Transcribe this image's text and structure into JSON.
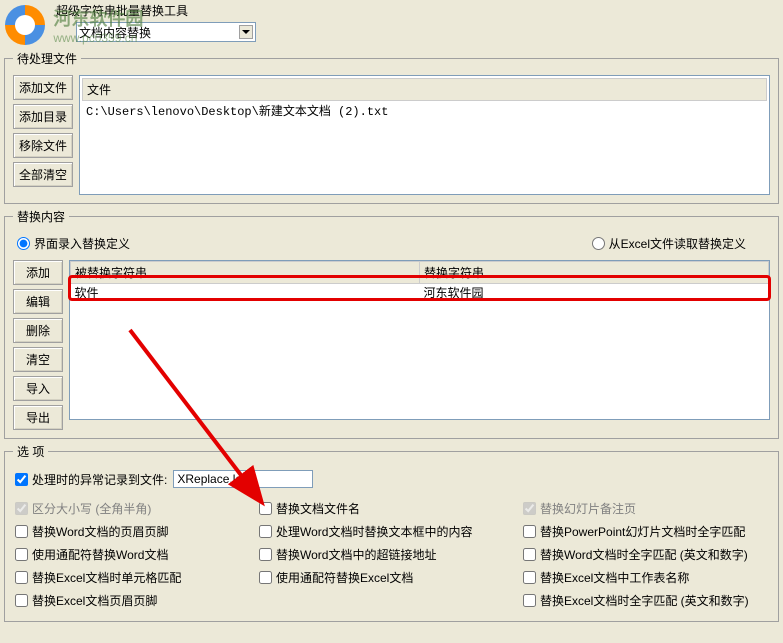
{
  "title": "超级字符串批量替换工具",
  "watermark": {
    "cn": "河东软件园",
    "url": "www.pc0359.cn"
  },
  "toolbar": {
    "mode_label": "文档内容替换"
  },
  "pending": {
    "legend": "待处理文件",
    "btn_add_file": "添加文件",
    "btn_add_dir": "添加目录",
    "btn_remove": "移除文件",
    "btn_clear": "全部清空",
    "col_header": "文件",
    "items": [
      "C:\\Users\\lenovo\\Desktop\\新建文本文档 (2).txt"
    ]
  },
  "replace": {
    "legend": "替换内容",
    "radio_ui": "界面录入替换定义",
    "radio_excel": "从Excel文件读取替换定义",
    "btn_add": "添加",
    "btn_edit": "编辑",
    "btn_delete": "删除",
    "btn_clear": "清空",
    "btn_import": "导入",
    "btn_export": "导出",
    "col_from": "被替换字符串",
    "col_to": "替换字符串",
    "rows": [
      {
        "from": "软件",
        "to": "河东软件园"
      }
    ]
  },
  "options": {
    "legend": "选  项",
    "log_label": "处理时的异常记录到文件:",
    "log_value": "XReplace.log",
    "c1r1": "区分大小写 (全角半角)",
    "c2r1": "替换文档文件名",
    "c3r1": "替换幻灯片备注页",
    "c1r2": "替换Word文档的页眉页脚",
    "c2r2": "处理Word文档时替换文本框中的内容",
    "c3r2": "替换PowerPoint幻灯片文档时全字匹配",
    "c1r3": "使用通配符替换Word文档",
    "c2r3": "替换Word文档中的超链接地址",
    "c3r3": "替换Word文档时全字匹配 (英文和数字)",
    "c1r4": "替换Excel文档时单元格匹配",
    "c2r4": "使用通配符替换Excel文档",
    "c3r4": "替换Excel文档中工作表名称",
    "c1r5": "替换Excel文档页眉页脚",
    "c3r5": "替换Excel文档时全字匹配 (英文和数字)"
  }
}
